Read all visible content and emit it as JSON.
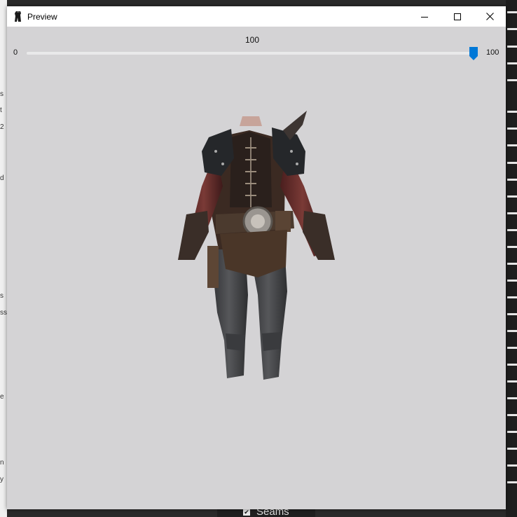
{
  "window": {
    "title": "Preview",
    "icon": "app-icon",
    "controls": [
      "minimize-icon",
      "maximize-icon",
      "close-icon"
    ]
  },
  "slider": {
    "value": "100",
    "min_label": "0",
    "max_label": "100",
    "level": 100,
    "accent": "#0078d7"
  },
  "preview": {
    "subject": "armor-model",
    "background": "#d4d3d5"
  },
  "background_app": {
    "left_fragments": [
      "s",
      "t",
      "2",
      "d",
      "s",
      "ss",
      "e",
      "n",
      "y"
    ],
    "bottom_checkbox_label": "Seams"
  }
}
